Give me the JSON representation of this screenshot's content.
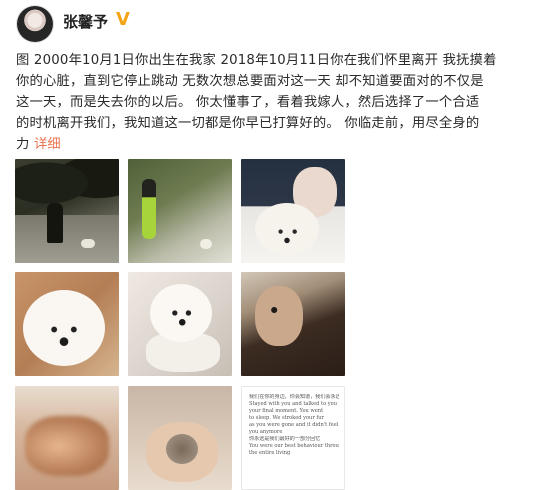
{
  "user": {
    "name": "张馨予",
    "verified_badge": "V",
    "avatar_icon": "avatar-portrait"
  },
  "post": {
    "lines": [
      "图 2000年10月1日你出生在我家 2018年10月11日你在我们怀里离开 我抚摸着",
      "你的心脏，直到它停止跳动 无数次想总要面对这一天 却不知道要面对的不仅是",
      "这一天，而是失去你的以后。 你太懂事了，看着我嫁人，然后选择了一个合适",
      "的时机离开我们，我知道这一切都是你早已打算好的。 你临走前，用尽全身的"
    ],
    "last_line": "力",
    "more_label": "详细"
  },
  "colors": {
    "link": "#eb7350",
    "badge": "#f4a414",
    "text": "#2a2a2a"
  },
  "photos": [
    {
      "label": "photo-night-walk"
    },
    {
      "label": "photo-green-jacket"
    },
    {
      "label": "photo-selfie-with-dog"
    },
    {
      "label": "photo-white-poodle-held"
    },
    {
      "label": "photo-poodle-closeup"
    },
    {
      "label": "photo-dog-on-floor"
    },
    {
      "label": "photo-blurred"
    },
    {
      "label": "photo-hand-fur"
    },
    {
      "label": "photo-text-card"
    }
  ],
  "text_card": {
    "lines": [
      "我们在你的身边，你会知道，我们会永远爱你",
      "Stayed with you and talked to you until",
      "your final moment. You went",
      "to sleep. We stroked your fur",
      "as you were gone and it didn't feel like",
      "you anymore",
      "",
      "你永远是我们最好的一部分回忆",
      "You were our best behaviour through",
      "the entire living"
    ]
  }
}
